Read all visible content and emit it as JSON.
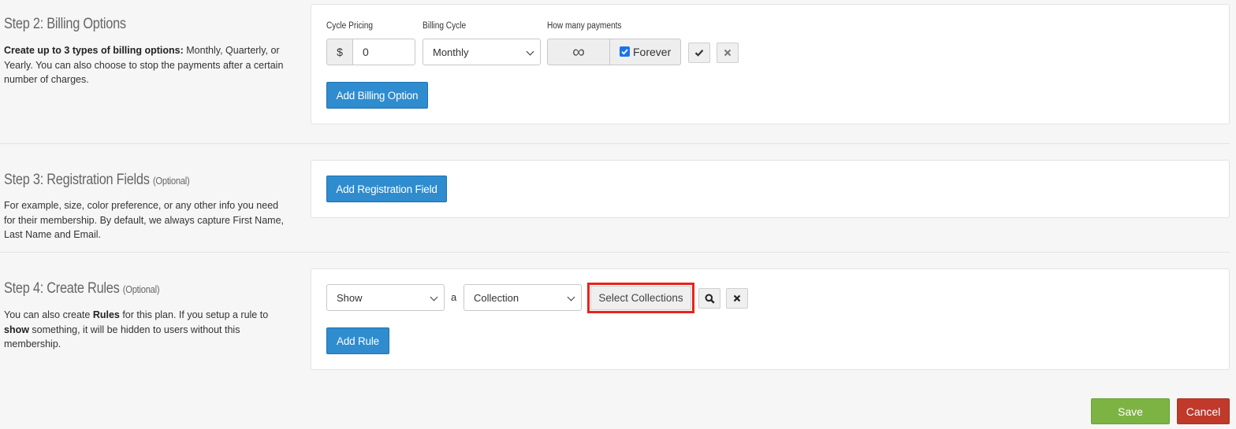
{
  "step2": {
    "title": "Step 2: Billing Options",
    "desc_bold": "Create up to 3 types of billing options:",
    "desc_rest": " Monthly, Quarterly, or Yearly. You can also choose to stop the payments after a certain number of charges.",
    "cycle_pricing_label": "Cycle Pricing",
    "currency_symbol": "$",
    "price_value": "0",
    "billing_cycle_label": "Billing Cycle",
    "billing_cycle_value": "Monthly",
    "payments_label": "How many payments",
    "payments_symbol": "∞",
    "forever_label": "Forever",
    "forever_checked": true,
    "add_button": "Add Billing Option"
  },
  "step3": {
    "title": "Step 3: Registration Fields",
    "optional": "(Optional)",
    "desc": "For example, size, color preference, or any other info you need for their membership. By default, we always capture First Name, Last Name and Email.",
    "add_button": "Add Registration Field"
  },
  "step4": {
    "title": "Step 4: Create Rules",
    "optional": "(Optional)",
    "desc_1": "You can also create ",
    "desc_bold_1": "Rules",
    "desc_2": " for this plan. If you setup a rule to ",
    "desc_bold_2": "show",
    "desc_3": " something, it will be hidden to users without this membership.",
    "action_value": "Show",
    "connector": "a",
    "type_value": "Collection",
    "select_button": "Select Collections",
    "add_button": "Add Rule",
    "highlight_color": "#e8231a"
  },
  "footer": {
    "save": "Save",
    "cancel": "Cancel"
  }
}
